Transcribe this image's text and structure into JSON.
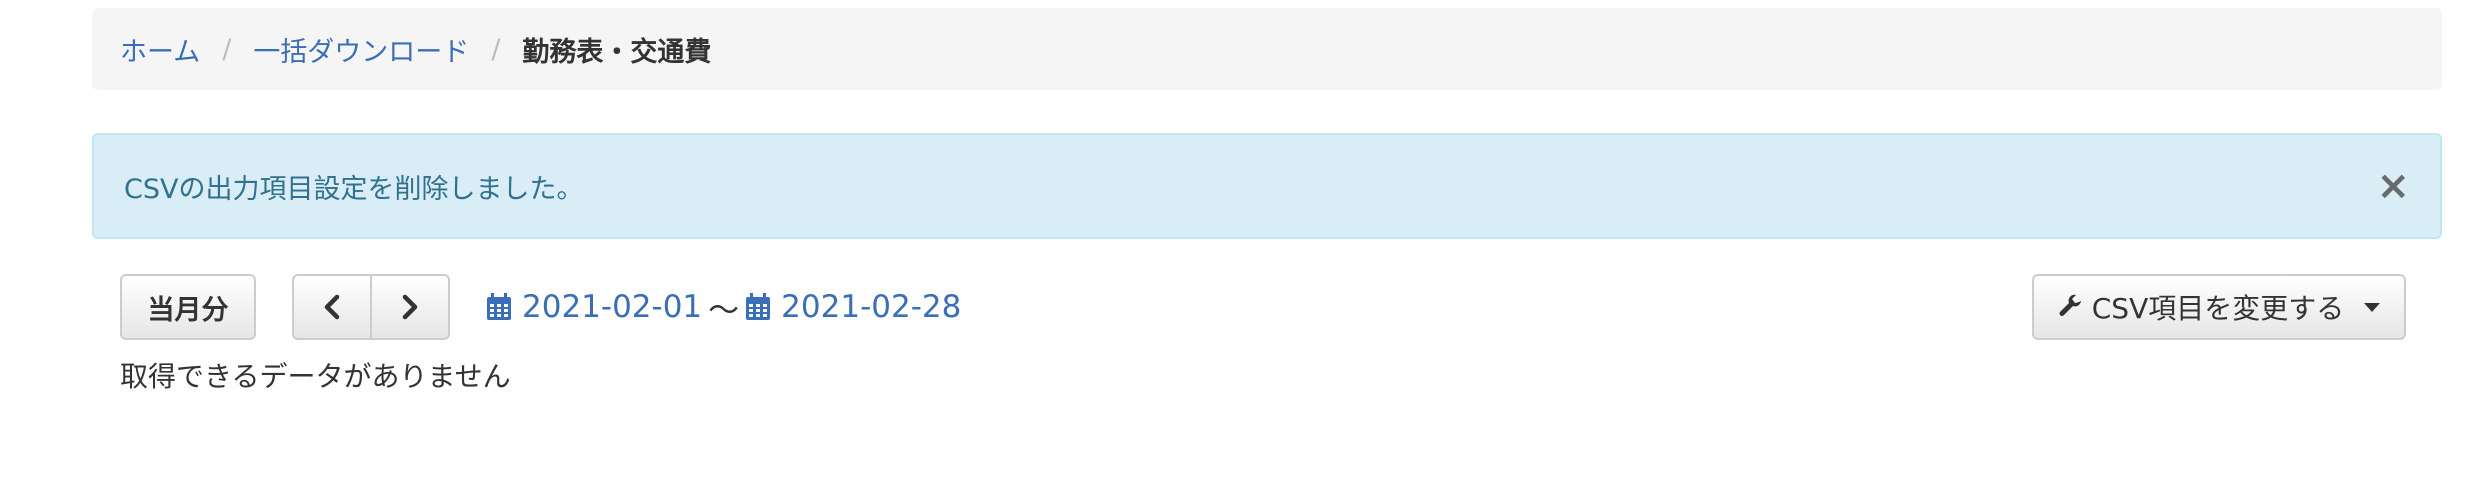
{
  "breadcrumb": {
    "home": "ホーム",
    "bulk": "一括ダウンロード",
    "current": "勤務表・交通費",
    "separator": "/"
  },
  "alert": {
    "message": "CSVの出力項目設定を削除しました。",
    "close": "×"
  },
  "toolbar": {
    "current_month": "当月分",
    "start_date": "2021-02-01",
    "range_separator": "〜",
    "end_date": "2021-02-28",
    "csv_button": "CSV項目を変更する"
  },
  "empty_message": "取得できるデータがありません",
  "colors": {
    "link": "#3a6fb7",
    "alert_bg": "#d9edf7",
    "alert_text": "#31708f"
  },
  "icons": [
    "chevron-left-icon",
    "chevron-right-icon",
    "calendar-icon",
    "wrench-icon",
    "caret-down-icon",
    "close-icon"
  ]
}
